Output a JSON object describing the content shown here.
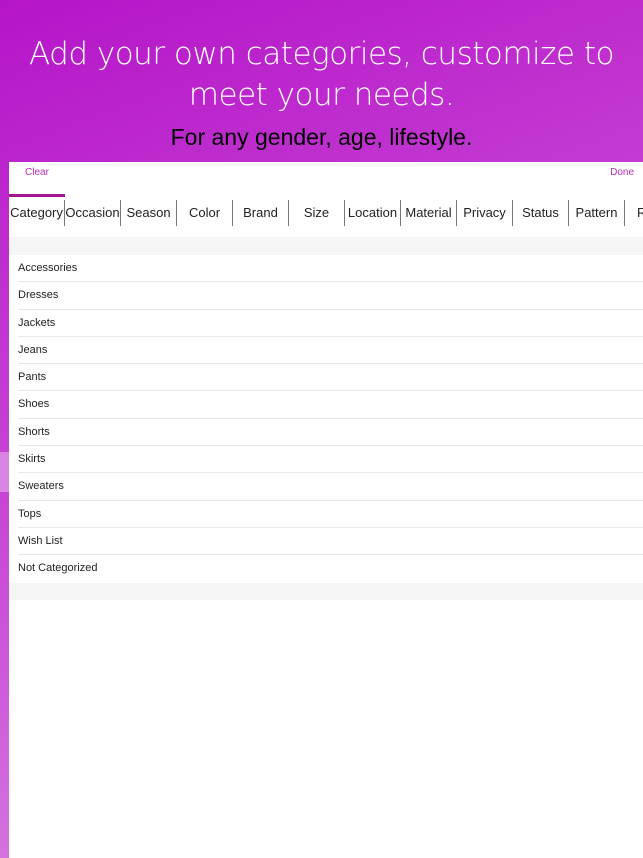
{
  "hero": {
    "title": "Add your own categories, customize to meet your needs.",
    "subtitle": "For any gender, age, lifestyle."
  },
  "toolbar": {
    "clear": "Clear",
    "done": "Done"
  },
  "tabs": [
    "Category",
    "Occasion",
    "Season",
    "Color",
    "Brand",
    "Size",
    "Location",
    "Material",
    "Privacy",
    "Status",
    "Pattern",
    "R"
  ],
  "active_tab": "Category",
  "items": [
    "Accessories",
    "Dresses",
    "Jackets",
    "Jeans",
    "Pants",
    "Shoes",
    "Shorts",
    "Skirts",
    "Sweaters",
    "Tops",
    "Wish List",
    "Not Categorized"
  ],
  "colors": {
    "accent": "#b92ab8",
    "underline": "#a3158f"
  }
}
